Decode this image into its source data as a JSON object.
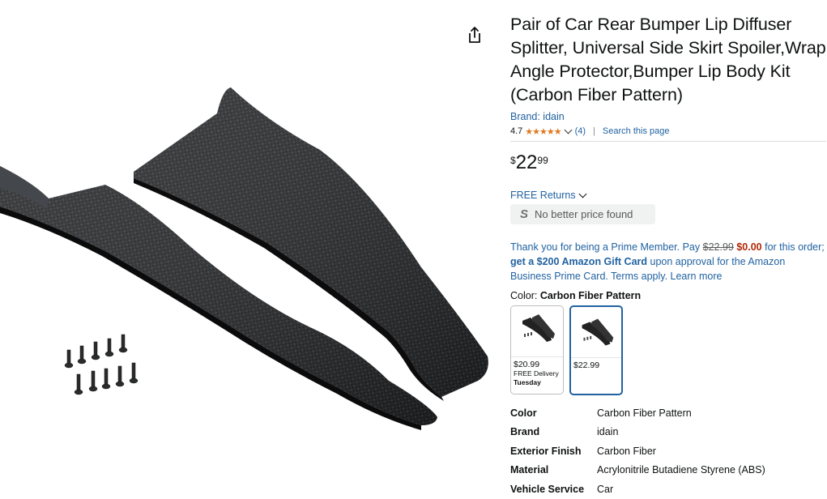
{
  "product": {
    "title": "Pair of Car Rear Bumper Lip Diffuser Splitter, Universal Side Skirt Spoiler,Wrap Angle Protector,Bumper Lip Body Kit (Carbon Fiber Pattern)",
    "brand_link": "Brand: idain",
    "rating_value": "4.7",
    "rating_stars": "★★★★★",
    "rating_count": "(4)",
    "search_link": "Search this page",
    "price": {
      "symbol": "$",
      "whole": "22",
      "fraction": "99"
    },
    "returns_label": "FREE Returns",
    "no_better_price": {
      "icon": "S",
      "label": "No better price found"
    },
    "promo": {
      "text1": "Thank you for being a Prime Member. Pay ",
      "old_price": "$22.99",
      "new_price": "$0.00",
      "text2": " for this order; ",
      "bold_text": "get a $200 Amazon Gift Card",
      "text3": " upon approval for the Amazon Business Prime Card. Terms apply. Learn more"
    },
    "color_label": "Color:",
    "color_value": "Carbon Fiber Pattern",
    "swatches": [
      {
        "price": "$20.99",
        "delivery": "FREE Delivery",
        "day": "Tuesday",
        "selected": false
      },
      {
        "price": "$22.99",
        "delivery": "",
        "day": "",
        "selected": true
      }
    ],
    "details": [
      {
        "key": "Color",
        "value": "Carbon Fiber Pattern"
      },
      {
        "key": "Brand",
        "value": "idain"
      },
      {
        "key": "Exterior Finish",
        "value": "Carbon Fiber"
      },
      {
        "key": "Material",
        "value": "Acrylonitrile Butadiene Styrene (ABS)"
      },
      {
        "key": "Vehicle Service",
        "value": "Car"
      }
    ]
  },
  "icons": {
    "share": "share-icon",
    "chevron": "chevron-down-icon"
  },
  "colors": {
    "link": "#2162a1",
    "star": "#de7921",
    "deal": "#b12704",
    "selected_border": "#2162a1"
  }
}
